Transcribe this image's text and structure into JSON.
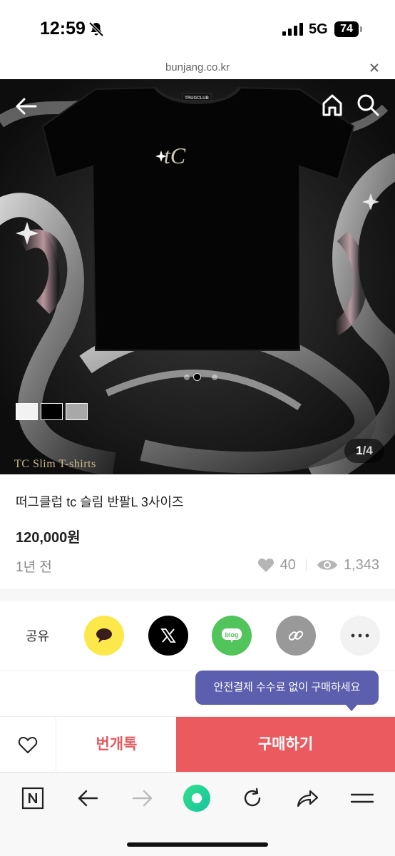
{
  "status_bar": {
    "time": "12:59",
    "network": "5G",
    "battery": "74",
    "icons": [
      "bell-slash-icon",
      "signal-icon",
      "battery-icon"
    ]
  },
  "browser": {
    "url": "bunjang.co.kr",
    "close_icon": "close-icon"
  },
  "hero": {
    "page_current": "1",
    "page_separator": "/",
    "page_total": "4",
    "caption": "TC Slim T-shirts",
    "shirt_neck_label": "TRUGCLUB",
    "shirt_logo": "tC",
    "carousel_dots": 3,
    "active_dot": 2,
    "thumbnail_colors": [
      "#f2f2f2",
      "#000000",
      "#a8a8a8"
    ],
    "icons": [
      "back-arrow-icon",
      "home-icon",
      "search-icon"
    ]
  },
  "product": {
    "title": "떠그클럽 tc 슬림 반팔L 3사이즈",
    "price": "120,000원",
    "posted": "1년 전",
    "likes": "40",
    "views": "1,343"
  },
  "share": {
    "label": "공유",
    "blog_label": "blog",
    "buttons": [
      {
        "name": "kakao",
        "icon": "speech-bubble-icon",
        "color": "#fce84a"
      },
      {
        "name": "x",
        "icon": "x-logo-icon",
        "color": "#000000"
      },
      {
        "name": "naver-blog",
        "icon": "blog-icon",
        "color": "#52c45c"
      },
      {
        "name": "copy-link",
        "icon": "link-icon",
        "color": "#999999"
      },
      {
        "name": "more",
        "icon": "more-dots-icon",
        "color": "#f2f2f2"
      }
    ]
  },
  "tooltip": "안전결제 수수료 없이 구매하세요",
  "actions": {
    "chat_label": "번개톡",
    "buy_label": "구매하기",
    "buy_color": "#ea5a5e",
    "chat_color": "#e85a5e"
  },
  "browser_toolbar": {
    "icons": [
      "naver-n-icon",
      "back-icon",
      "forward-icon",
      "green-circle-icon",
      "reload-icon",
      "share-icon",
      "menu-icon"
    ]
  }
}
